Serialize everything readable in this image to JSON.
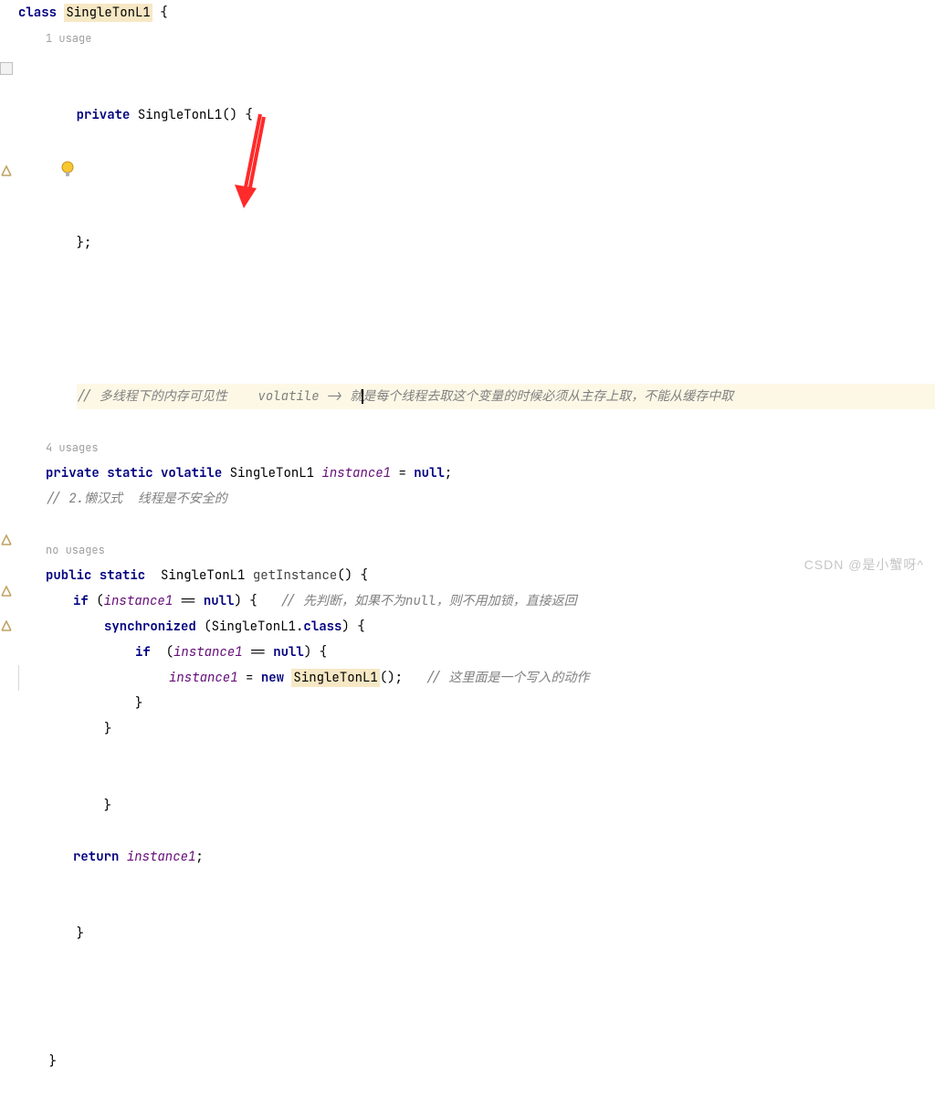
{
  "code": {
    "class_kw": "class",
    "class_name": "SingleTonL1",
    "open_brace": " {",
    "usage1": "1 usage",
    "private_kw": "private",
    "ctor_name": "SingleTonL1",
    "ctor_params": "() {",
    "close_brace_semi": "};",
    "comment_volatile_a": "// 多线程下的内存可见性",
    "comment_volatile_b": " volatile -> 就",
    "comment_volatile_c": "是每个线程去取这个变量的时候必须从主存上取，不能从缓存中取",
    "usage4": "4 usages",
    "static_kw": "static",
    "volatile_kw": "volatile",
    "field_type": "SingleTonL1",
    "field_name": "instance1",
    "field_assign": " = ",
    "null_kw": "null",
    "semi": ";",
    "comment_lazy": "// 2.懒汉式  线程是不安全的",
    "no_usages": "no usages",
    "public_kw": "public",
    "ret_type": "SingleTonL1",
    "method_name": "getInstance",
    "method_params": "() {",
    "if_kw": "if",
    "cond_open": " (",
    "cond_var": "instance1",
    "cond_eq": " == ",
    "cond_null": "null",
    "cond_close": ") {",
    "comment_if": "// 先判断，如果不为null，则不用加锁，直接返回",
    "sync_kw": "synchronized",
    "sync_arg": " (SingleTonL1.",
    "class_lit": "class",
    "sync_close": ") {",
    "if2_kw": "if",
    "cond2_open": "  (",
    "cond2_var": "instance1",
    "cond2_eq": " == ",
    "cond2_null": "null",
    "cond2_close": ") {",
    "assign_var": "instance1",
    "assign_eq": " = ",
    "new_kw": "new",
    "ctor_call": "SingleTonL1",
    "ctor_call_end": "();",
    "comment_write": "// 这里面是一个写入的动作",
    "brace_close": "}",
    "return_kw": "return",
    "return_var": "instance1",
    "final_brace": "}"
  },
  "watermark": "CSDN @是小蟹呀^"
}
